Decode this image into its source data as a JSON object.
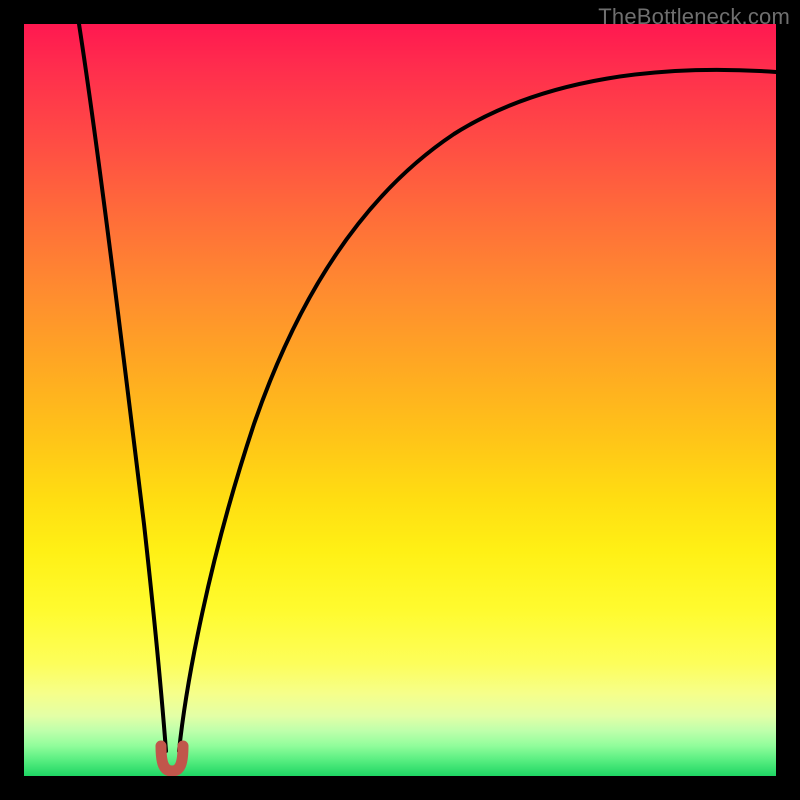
{
  "watermark": "TheBottleneck.com",
  "colors": {
    "frame": "#000000",
    "curve": "#000000",
    "marker_fill": "#c1564b",
    "marker_stroke": "#9e3f35",
    "gradient_top": "#ff1850",
    "gradient_mid": "#ffe015",
    "gradient_bottom": "#1ed563"
  },
  "chart_data": {
    "type": "line",
    "title": "",
    "xlabel": "",
    "ylabel": "",
    "xlim": [
      0,
      100
    ],
    "ylim": [
      0,
      100
    ],
    "grid": false,
    "legend": false,
    "note": "V-shaped curve: black line drops from near 100 at x≈7 to ~0 at x≈19, then rises asymptotically toward ~95 at x=100. A short reddish U-shaped marker sits at the minimum.",
    "series": [
      {
        "name": "left-branch",
        "x": [
          7,
          9,
          11,
          13,
          15,
          17,
          18.5
        ],
        "y": [
          100,
          84,
          67,
          50,
          33,
          15,
          3
        ]
      },
      {
        "name": "right-branch",
        "x": [
          20.5,
          22,
          25,
          30,
          35,
          40,
          50,
          60,
          70,
          80,
          90,
          100
        ],
        "y": [
          3,
          12,
          30,
          49,
          60,
          67,
          77,
          83,
          87,
          90,
          92,
          94
        ]
      },
      {
        "name": "minimum-marker",
        "x": [
          18.2,
          18.7,
          19.5,
          20.3,
          20.8
        ],
        "y": [
          4,
          1.2,
          0.6,
          1.2,
          4
        ]
      }
    ],
    "minimum": {
      "x": 19.5,
      "y": 0.6
    }
  }
}
